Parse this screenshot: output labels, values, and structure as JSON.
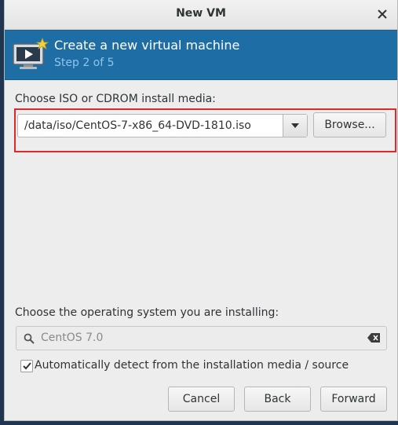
{
  "window": {
    "title": "New VM"
  },
  "banner": {
    "title": "Create a new virtual machine",
    "step": "Step 2 of 5"
  },
  "media": {
    "label": "Choose ISO or CDROM install media:",
    "path": "/data/iso/CentOS-7-x86_64-DVD-1810.iso",
    "browse_label": "Browse..."
  },
  "os": {
    "label": "Choose the operating system you are installing:",
    "value": "CentOS 7.0",
    "auto_detect_label": "Automatically detect from the installation media / source",
    "auto_detect_checked": true
  },
  "footer": {
    "cancel_label": "Cancel",
    "back_label": "Back",
    "forward_label": "Forward"
  },
  "colors": {
    "banner": "#1e6ea5",
    "highlight": "#e02828"
  },
  "icons": [
    "close-icon",
    "vm-monitor-icon",
    "dropdown-arrow-icon",
    "search-icon",
    "clear-icon",
    "checkmark-icon"
  ]
}
